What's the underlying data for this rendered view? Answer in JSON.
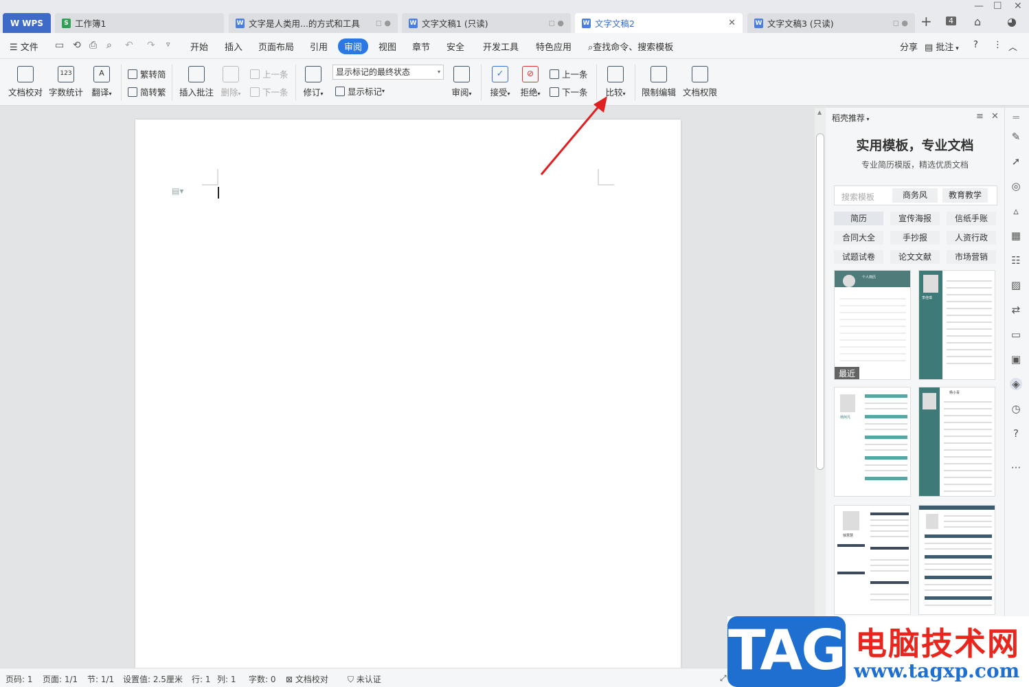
{
  "tabs": {
    "wps": "WPS",
    "items": [
      {
        "label": "工作簿1",
        "kind": "xls",
        "extra": ""
      },
      {
        "label": "文字是人类用...的方式和工具",
        "kind": "doc",
        "extra": "◻ ●"
      },
      {
        "label": "文字文稿1 (只读)",
        "kind": "doc",
        "extra": "◻ ●"
      },
      {
        "label": "文字文稿2",
        "kind": "doc",
        "extra": "✕"
      },
      {
        "label": "文字文稿3 (只读)",
        "kind": "doc",
        "extra": "◻ ●"
      }
    ],
    "count_badge": "4"
  },
  "menu": {
    "file": "文件",
    "items": [
      "开始",
      "插入",
      "页面布局",
      "引用",
      "审阅",
      "视图",
      "章节",
      "安全",
      "开发工具",
      "特色应用"
    ],
    "search": "查找命令、搜索模板",
    "share": "分享",
    "annotate": "批注",
    "help": "?"
  },
  "ribbon": {
    "proofread": "文档校对",
    "wordcount": "字数统计",
    "translate": "翻译",
    "trad": "繁转简",
    "simp": "简转繁",
    "insert_comment": "插入批注",
    "delete": "删除",
    "prev": "上一条",
    "next": "下一条",
    "revise": "修订",
    "markup_state": "显示标记的最终状态",
    "show_markup": "显示标记",
    "review": "审阅",
    "accept": "接受",
    "reject": "拒绝",
    "prev2": "上一条",
    "next2": "下一条",
    "compare": "比较",
    "restrict": "限制编辑",
    "permission": "文档权限"
  },
  "panel": {
    "header": "稻壳推荐",
    "title": "实用模板，专业文档",
    "subtitle": "专业简历模版，精选优质文档",
    "search_placeholder": "搜索模板",
    "search_tags": [
      "商务风",
      "教育教学"
    ],
    "chips": [
      "简历",
      "宣传海报",
      "信纸手账",
      "合同大全",
      "手抄报",
      "人资行政",
      "试题试卷",
      "论文文献",
      "市场营销"
    ],
    "recent_badge": "最近",
    "template_names": [
      "个人简历",
      "李佳琪",
      "杨阿凡",
      "杨小青",
      "徐慧慧"
    ]
  },
  "status": {
    "page_num": "页码: 1",
    "pages": "页面: 1/1",
    "section": "节: 1/1",
    "setting": "设置值: 2.5厘米",
    "row": "行: 1",
    "col": "列: 1",
    "words": "字数: 0",
    "proof": "文档校对",
    "cert": "未认证"
  },
  "watermark": {
    "tag": "TAG",
    "cn": "电脑技术网",
    "url": "www.tagxp.com"
  },
  "colors": {
    "accent": "#2a78e4",
    "arrow": "#e02020",
    "wps_tab": "#3e6bc8",
    "resume_teal": "#3d7a78"
  }
}
